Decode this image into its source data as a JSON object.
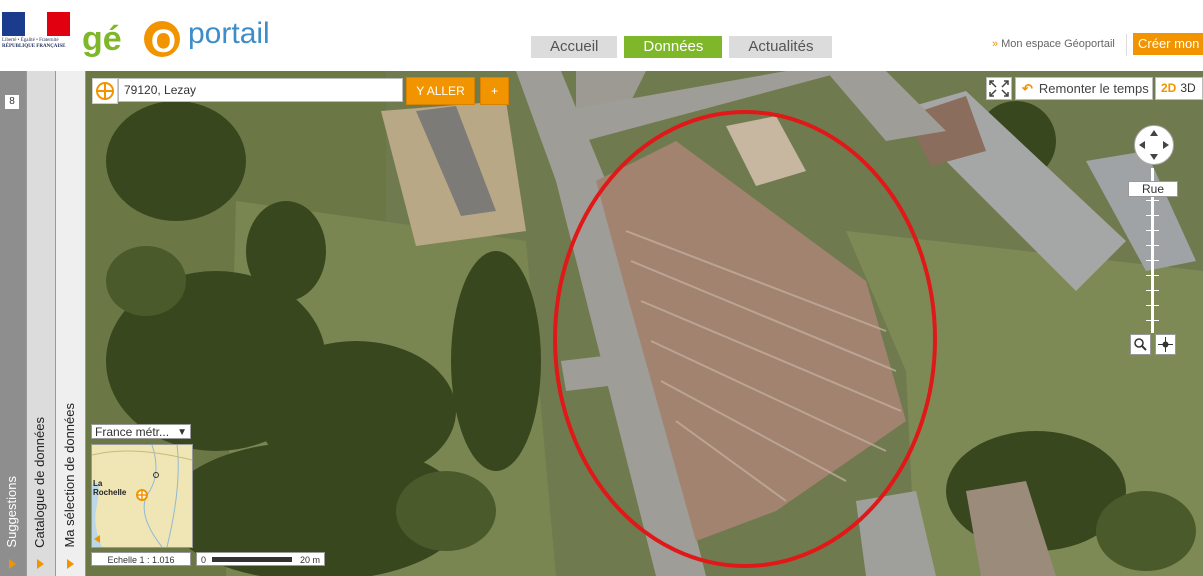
{
  "header": {
    "republique_lines": [
      "Liberté • Égalité • Fraternité",
      "RÉPUBLIQUE FRANÇAISE"
    ],
    "logo_part1": "gé",
    "logo_part2": "O",
    "logo_part3": "portail",
    "nav": [
      "Accueil",
      "Données",
      "Actualités"
    ],
    "nav_active": "Données",
    "espace_arrow": "»",
    "espace_link": "Mon espace Géoportail",
    "creer_button": "Créer mon"
  },
  "sidebar": {
    "badge": "8",
    "items": [
      "Suggestions",
      "Catalogue de données",
      "Ma sélection de données"
    ]
  },
  "search": {
    "value": "79120, Lezay",
    "go_button": "Y ALLER",
    "plus_button": "+"
  },
  "controls": {
    "remonter": "Remonter le temps",
    "mode_2d": "2D",
    "mode_3d": "3D",
    "zoom_label": "Rue"
  },
  "overview": {
    "select_value": "France métr...",
    "place_label_1": "La",
    "place_label_2": "Rochelle",
    "scale_text": "Echelle 1 :  1.016",
    "scale_start": "0",
    "scale_end": "20 m"
  },
  "colors": {
    "accent_orange": "#f29400",
    "nav_active_green": "#7fb72a",
    "highlight_circle": "#e01818"
  },
  "icons": [
    "locate-icon",
    "fullscreen-icon",
    "undo-icon",
    "pan-arrows-icon",
    "magnifier-icon",
    "crosshair-icon",
    "triangle-right-icon",
    "chevron-down-icon"
  ]
}
